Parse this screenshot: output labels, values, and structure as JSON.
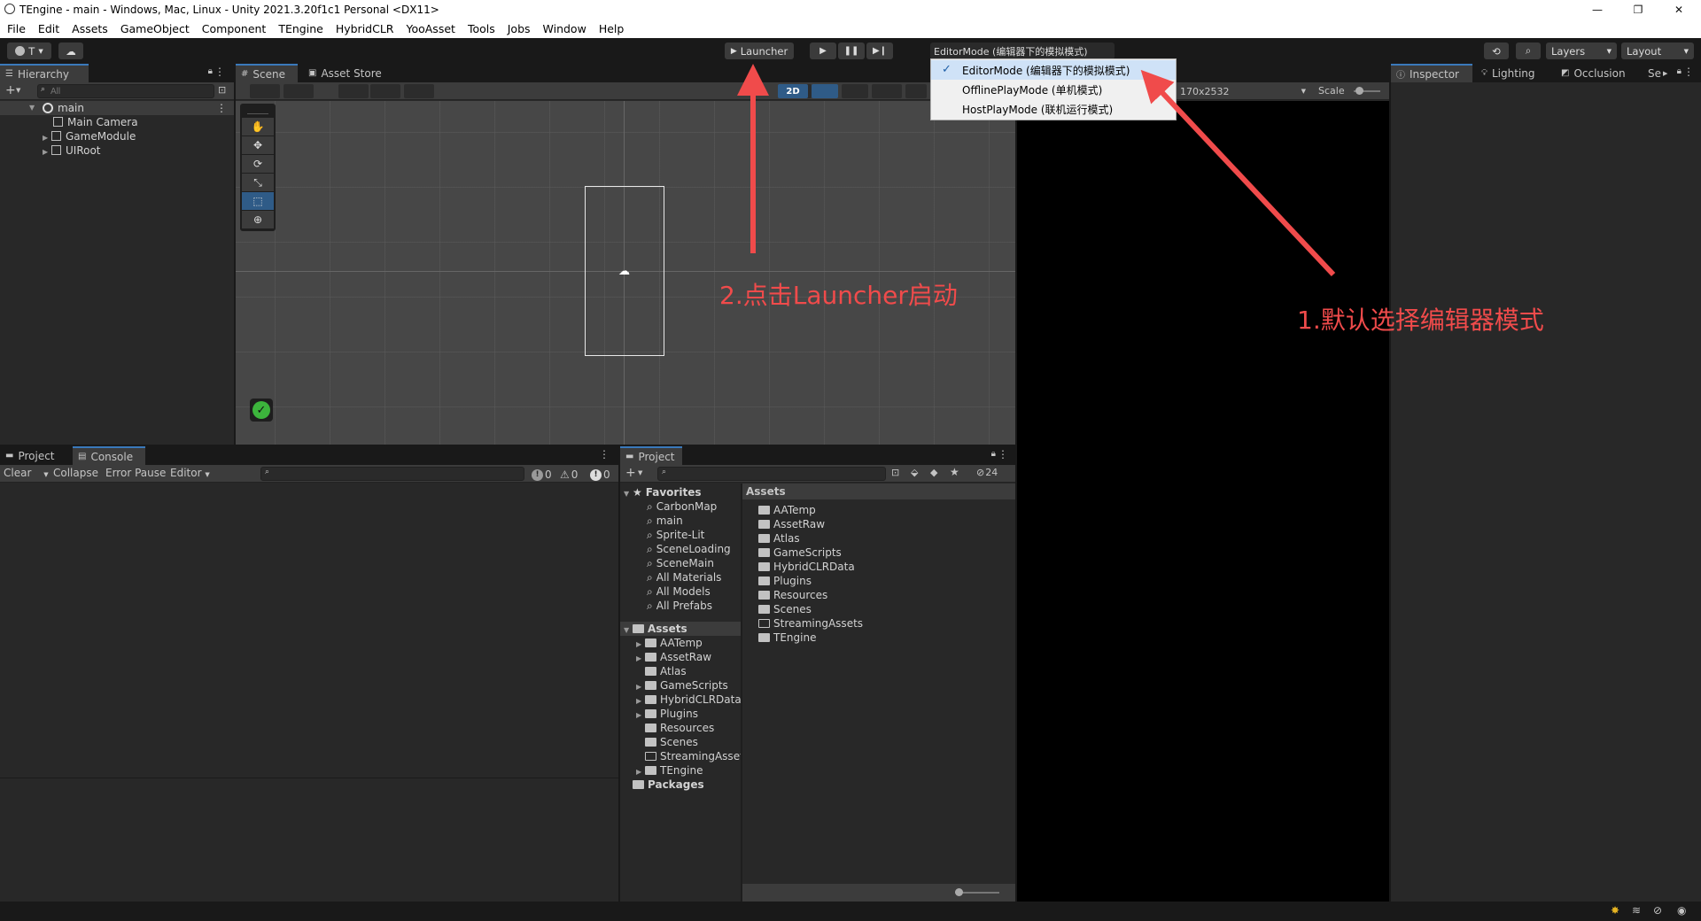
{
  "window": {
    "title": "TEngine - main - Windows, Mac, Linux - Unity 2021.3.20f1c1 Personal <DX11>",
    "minimize": "—",
    "restore": "❐",
    "close": "✕"
  },
  "menu": [
    "File",
    "Edit",
    "Assets",
    "GameObject",
    "Component",
    "TEngine",
    "HybridCLR",
    "YooAsset",
    "Tools",
    "Jobs",
    "Window",
    "Help"
  ],
  "toolbar": {
    "account_label": "T",
    "launcher_label": "Launcher",
    "play_mode_dropdown": "EditorMode (编辑器下的模拟模式)",
    "layers_label": "Layers",
    "layout_label": "Layout"
  },
  "play_mode_menu": {
    "items": [
      {
        "label": "EditorMode (编辑器下的模拟模式)",
        "checked": true
      },
      {
        "label": "OfflinePlayMode (单机模式)",
        "checked": false
      },
      {
        "label": "HostPlayMode (联机运行模式)",
        "checked": false
      }
    ]
  },
  "hierarchy": {
    "tab": "Hierarchy",
    "search_placeholder": "All",
    "scene": "main",
    "items": [
      "Main Camera",
      "GameModule",
      "UIRoot"
    ]
  },
  "scene": {
    "tabs": [
      "Scene",
      "Asset Store"
    ],
    "mode_2d": "2D"
  },
  "game": {
    "resolution": "170x2532",
    "scale_label": "Scale"
  },
  "inspector": {
    "tabs": [
      "Inspector",
      "Lighting",
      "Occlusion",
      "Se"
    ]
  },
  "console": {
    "tabs": [
      "Project",
      "Console"
    ],
    "buttons": [
      "Clear",
      "Collapse",
      "Error Pause",
      "Editor"
    ],
    "counts": {
      "logs": "0",
      "warnings": "0",
      "errors": "0"
    }
  },
  "project": {
    "tab": "Project",
    "hidden_count": "24",
    "favorites_label": "Favorites",
    "favorites": [
      "CarbonMap",
      "main",
      "Sprite-Lit",
      "SceneLoading",
      "SceneMain",
      "All Materials",
      "All Models",
      "All Prefabs"
    ],
    "assets_label": "Assets",
    "asset_tree": [
      {
        "name": "AATemp",
        "expandable": true,
        "empty": false
      },
      {
        "name": "AssetRaw",
        "expandable": true,
        "empty": false
      },
      {
        "name": "Atlas",
        "expandable": false,
        "empty": false
      },
      {
        "name": "GameScripts",
        "expandable": true,
        "empty": false
      },
      {
        "name": "HybridCLRData",
        "expandable": true,
        "empty": false
      },
      {
        "name": "Plugins",
        "expandable": true,
        "empty": false
      },
      {
        "name": "Resources",
        "expandable": false,
        "empty": false
      },
      {
        "name": "Scenes",
        "expandable": false,
        "empty": false
      },
      {
        "name": "StreamingAsset",
        "expandable": false,
        "empty": true
      },
      {
        "name": "TEngine",
        "expandable": true,
        "empty": false
      }
    ],
    "packages_label": "Packages",
    "grid_header": "Assets",
    "grid_items": [
      {
        "name": "AATemp",
        "empty": false
      },
      {
        "name": "AssetRaw",
        "empty": false
      },
      {
        "name": "Atlas",
        "empty": false
      },
      {
        "name": "GameScripts",
        "empty": false
      },
      {
        "name": "HybridCLRData",
        "empty": false
      },
      {
        "name": "Plugins",
        "empty": false
      },
      {
        "name": "Resources",
        "empty": false
      },
      {
        "name": "Scenes",
        "empty": false
      },
      {
        "name": "StreamingAssets",
        "empty": true
      },
      {
        "name": "TEngine",
        "empty": false
      }
    ]
  },
  "annotations": {
    "step1": "1.默认选择编辑器模式",
    "step2": "2.点击Launcher启动"
  },
  "colors": {
    "annotation": "#f04b4b",
    "accent": "#3a79bb",
    "menu_selected": "#cfe2f7",
    "checkmark_green": "#3cb43c"
  }
}
